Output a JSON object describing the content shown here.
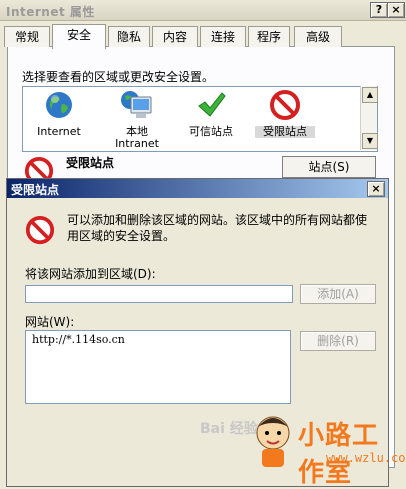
{
  "back_window": {
    "title": "Internet 属性",
    "help_glyph": "?",
    "close_glyph": "×",
    "tabs": [
      {
        "label": "常规"
      },
      {
        "label": "安全"
      },
      {
        "label": "隐私"
      },
      {
        "label": "内容"
      },
      {
        "label": "连接"
      },
      {
        "label": "程序"
      },
      {
        "label": "高级"
      }
    ],
    "active_tab": "安全",
    "prompt": "选择要查看的区域或更改安全设置。",
    "zones": [
      {
        "label": "Internet",
        "icon": "globe-icon"
      },
      {
        "label": "本地\nIntranet",
        "icon": "monitor-globe-icon"
      },
      {
        "label": "可信站点",
        "icon": "checkmark-icon"
      },
      {
        "label": "受限站点",
        "icon": "no-entry-icon",
        "selected": true
      }
    ],
    "restricted_heading": "受限站点",
    "sites_button": "站点(S)"
  },
  "dialog": {
    "title": "受限站点",
    "close_glyph": "×",
    "info_text": "可以添加和删除该区域的网站。该区域中的所有网站都使用区域的安全设置。",
    "add_label": "将该网站添加到区域(D):",
    "add_value": "",
    "add_button": "添加(A)",
    "sites_label": "网站(W):",
    "sites": [
      "http://*.114so.cn"
    ],
    "remove_button": "删除(R)"
  },
  "watermark": {
    "text": "小路工作室",
    "url": "www.wzlu.com",
    "baidu": "Bai 经验"
  },
  "colors": {
    "accent_title": "#0a246a",
    "watermark": "#f3791f"
  }
}
